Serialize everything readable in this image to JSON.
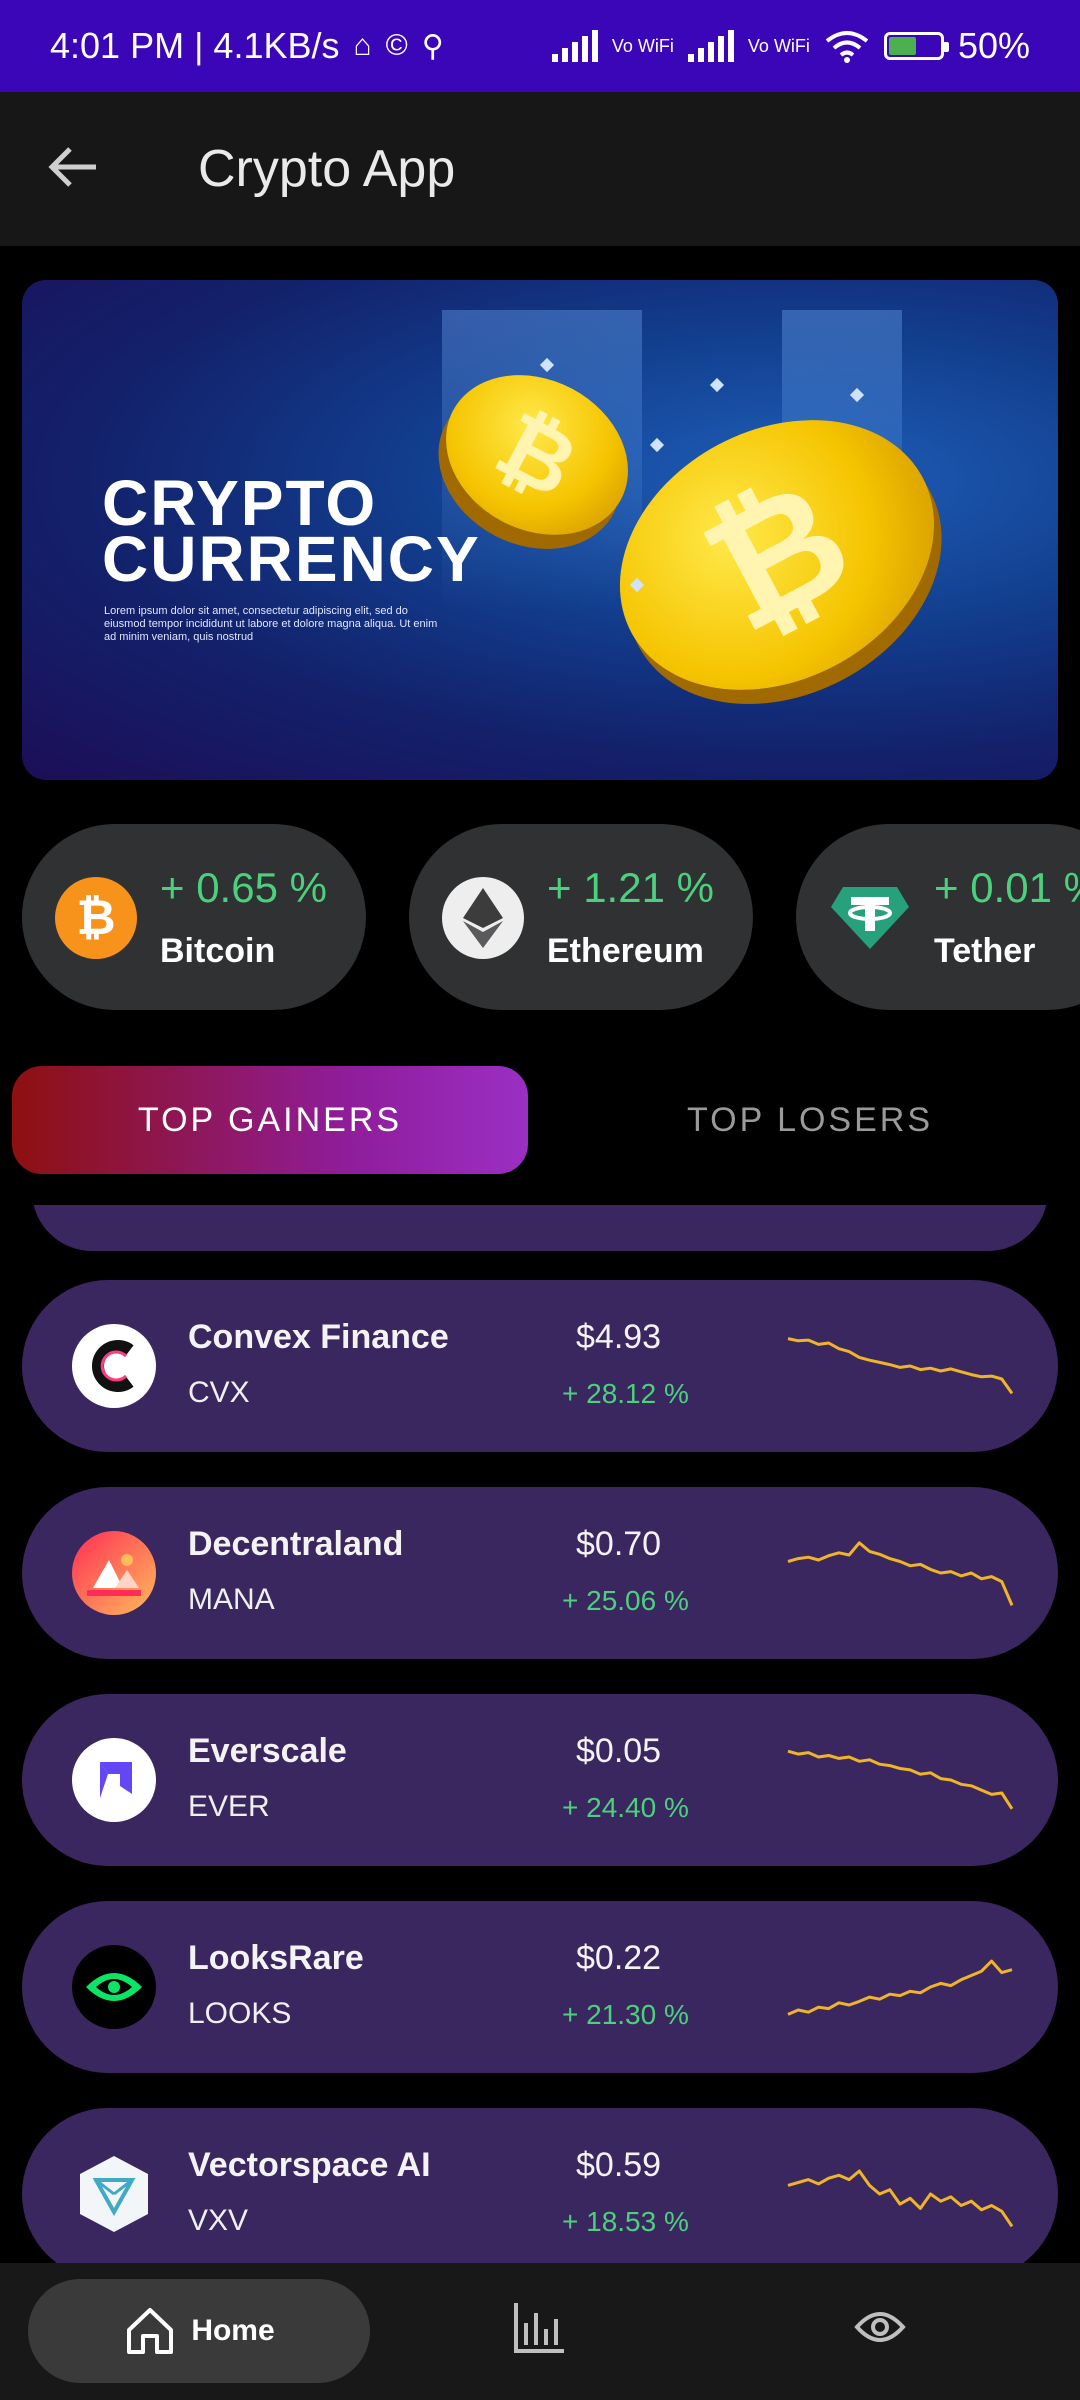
{
  "status_bar": {
    "time_net": "4:01 PM | 4.1KB/s",
    "vowifi_1": "Vo WiFi",
    "vowifi_2": "Vo WiFi",
    "battery": "50%"
  },
  "app_bar": {
    "title": "Crypto App"
  },
  "banner": {
    "title_line1": "CRYPTO",
    "title_line2": "CURRENCY",
    "subtitle": "Lorem ipsum dolor sit amet, consectetur adipiscing elit, sed do eiusmod tempor incididunt ut labore et dolore magna aliqua. Ut enim ad minim veniam, quis nostrud"
  },
  "ticker": [
    {
      "name": "Bitcoin",
      "change": "+ 0.65 %",
      "icon": "bitcoin-icon",
      "color": "#f7931a"
    },
    {
      "name": "Ethereum",
      "change": "+ 1.21 %",
      "icon": "ethereum-icon",
      "color": "#eeeeee"
    },
    {
      "name": "Tether",
      "change": "+ 0.01 %",
      "icon": "tether-icon",
      "color": "#26a17b"
    }
  ],
  "tabs": {
    "gainers": "TOP GAINERS",
    "losers": "TOP LOSERS"
  },
  "gainers": [
    {
      "name": "Convex Finance",
      "symbol": "CVX",
      "price": "$4.93",
      "change": "+ 28.12 %",
      "icon": "convex-finance-icon",
      "sparkline": [
        0.88,
        0.85,
        0.86,
        0.8,
        0.82,
        0.74,
        0.7,
        0.62,
        0.58,
        0.55,
        0.52,
        0.48,
        0.5,
        0.45,
        0.47,
        0.43,
        0.46,
        0.42,
        0.38,
        0.35,
        0.36,
        0.32,
        0.12
      ]
    },
    {
      "name": "Decentraland",
      "symbol": "MANA",
      "price": "$0.70",
      "change": "+ 25.06 %",
      "icon": "decentraland-icon",
      "sparkline": [
        0.66,
        0.7,
        0.72,
        0.68,
        0.74,
        0.78,
        0.75,
        0.92,
        0.8,
        0.76,
        0.7,
        0.66,
        0.6,
        0.62,
        0.55,
        0.5,
        0.52,
        0.46,
        0.5,
        0.42,
        0.45,
        0.38,
        0.05
      ]
    },
    {
      "name": "Everscale",
      "symbol": "EVER",
      "price": "$0.05",
      "change": "+ 24.40 %",
      "icon": "everscale-icon",
      "sparkline": [
        0.9,
        0.86,
        0.88,
        0.82,
        0.84,
        0.8,
        0.82,
        0.76,
        0.78,
        0.72,
        0.7,
        0.66,
        0.64,
        0.58,
        0.6,
        0.52,
        0.5,
        0.44,
        0.42,
        0.36,
        0.3,
        0.32,
        0.1
      ]
    },
    {
      "name": "LooksRare",
      "symbol": "LOOKS",
      "price": "$0.22",
      "change": "+ 21.30 %",
      "icon": "looksrare-icon",
      "sparkline": [
        0.12,
        0.18,
        0.15,
        0.22,
        0.2,
        0.28,
        0.25,
        0.3,
        0.36,
        0.33,
        0.4,
        0.38,
        0.44,
        0.42,
        0.5,
        0.55,
        0.52,
        0.6,
        0.66,
        0.72,
        0.86,
        0.7,
        0.74
      ]
    },
    {
      "name": "Vectorspace AI",
      "symbol": "VXV",
      "price": "$0.59",
      "change": "+ 18.53 %",
      "icon": "vectorspace-ai-icon",
      "sparkline": [
        0.62,
        0.66,
        0.7,
        0.64,
        0.72,
        0.76,
        0.7,
        0.82,
        0.62,
        0.5,
        0.56,
        0.36,
        0.44,
        0.3,
        0.5,
        0.4,
        0.46,
        0.34,
        0.4,
        0.28,
        0.34,
        0.26,
        0.05
      ]
    }
  ],
  "bottom_nav": {
    "home": "Home"
  },
  "colors": {
    "accent_green": "#4cd07d",
    "sparkline": "#f0b429",
    "row_bg": "#3b2760"
  }
}
